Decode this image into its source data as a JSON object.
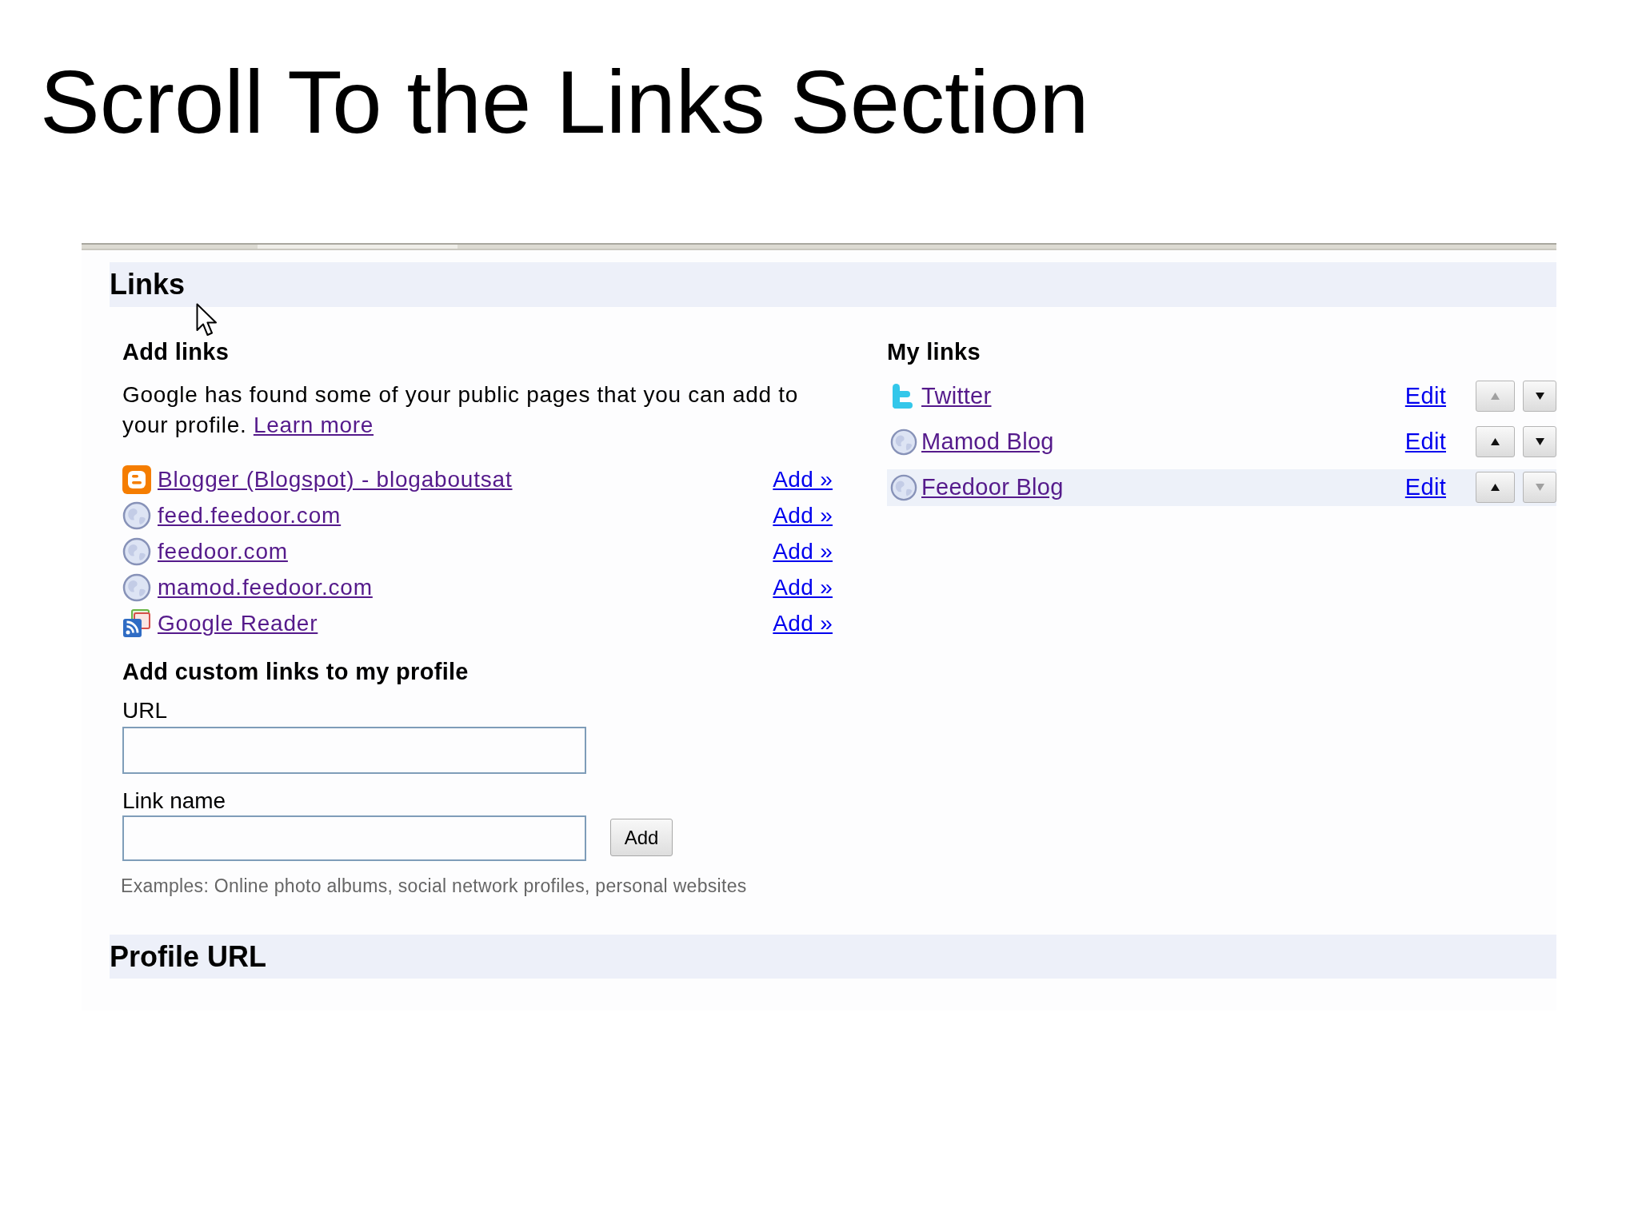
{
  "slide": {
    "title": "Scroll To the Links Section"
  },
  "links_section": {
    "title": "Links",
    "add_links": {
      "heading": "Add links",
      "intro": "Google has found some of your public pages that you can add to your profile.",
      "learn_more": "Learn more",
      "items": [
        {
          "kind": "blogger",
          "label": "Blogger (Blogspot) - blogaboutsat",
          "action": "Add »"
        },
        {
          "kind": "globe",
          "label": "feed.feedoor.com",
          "action": "Add »"
        },
        {
          "kind": "globe",
          "label": "feedoor.com",
          "action": "Add »"
        },
        {
          "kind": "globe",
          "label": "mamod.feedoor.com",
          "action": "Add »"
        },
        {
          "kind": "reader",
          "label": "Google Reader",
          "action": "Add »"
        }
      ]
    },
    "custom_links": {
      "heading": "Add custom links to my profile",
      "fields": [
        {
          "label": "URL"
        },
        {
          "label": "Link name"
        }
      ],
      "button": "Add",
      "hint": "Examples: Online photo albums, social network profiles, personal websites"
    },
    "my_links": {
      "heading": "My links",
      "items": [
        {
          "kind": "twitter",
          "label": "Twitter",
          "action": "Edit",
          "highlighted": false,
          "up_disabled": true,
          "down_disabled": false
        },
        {
          "kind": "globe",
          "label": "Mamod Blog",
          "action": "Edit",
          "highlighted": false,
          "up_disabled": false,
          "down_disabled": false
        },
        {
          "kind": "globe",
          "label": "Feedoor Blog",
          "action": "Edit",
          "highlighted": true,
          "up_disabled": false,
          "down_disabled": true
        }
      ]
    }
  },
  "profile_url_section": {
    "title": "Profile URL"
  }
}
